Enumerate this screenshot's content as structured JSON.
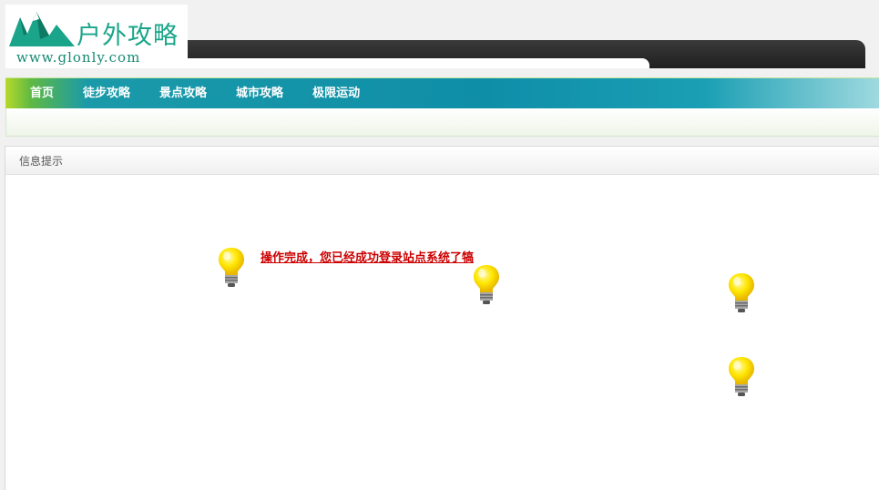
{
  "logo": {
    "brand": "户外攻略",
    "domain": "www.glonly.com"
  },
  "nav": {
    "items": [
      "首页",
      "徒步攻略",
      "景点攻略",
      "城市攻略",
      "极限运动"
    ]
  },
  "panel": {
    "title": "信息提示",
    "message": "操作完成，您已经成功登录站点系统了犒"
  },
  "colors": {
    "brand_green": "#1aa58a",
    "nav_teal": "#0f8ea8",
    "message_red": "#cc0000"
  }
}
